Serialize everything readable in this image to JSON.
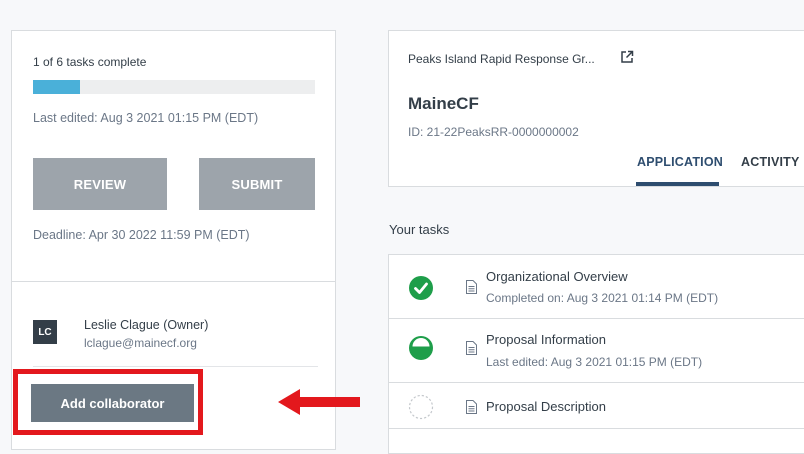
{
  "left_panel": {
    "progress_text": "1 of 6 tasks complete",
    "progress_fraction": 0.167,
    "progress_color": "#4ab0d9",
    "last_edited": "Last edited: Aug 3 2021 01:15 PM (EDT)",
    "review_label": "REVIEW",
    "submit_label": "SUBMIT",
    "deadline": "Deadline: Apr 30 2022 11:59 PM (EDT)",
    "collaborator": {
      "initials": "LC",
      "name": "Leslie Clague (Owner)",
      "email": "lclague@mainecf.org"
    },
    "add_collaborator_label": "Add collaborator",
    "highlight_color": "#e3181d"
  },
  "application": {
    "name": "Peaks Island Rapid Response Gr...",
    "organization": "MaineCF",
    "id": "ID: 21-22PeaksRR-0000000002",
    "tabs": [
      {
        "label": "APPLICATION",
        "active": true
      },
      {
        "label": "ACTIVITY",
        "active": false
      }
    ]
  },
  "tasks": {
    "heading": "Your tasks",
    "items": [
      {
        "title": "Organizational Overview",
        "subtitle": "Completed on: Aug 3 2021 01:14 PM (EDT)",
        "status": "complete",
        "icon": "check-circle-icon"
      },
      {
        "title": "Proposal Information",
        "subtitle": "Last edited: Aug 3 2021 01:15 PM (EDT)",
        "status": "in-progress",
        "icon": "half-circle-icon"
      },
      {
        "title": "Proposal Description",
        "subtitle": "",
        "status": "not-started",
        "icon": "empty-circle-icon"
      }
    ]
  },
  "colors": {
    "complete": "#1e9e4a",
    "accent_tab": "#2e4d6f",
    "arrow": "#e3181d"
  }
}
